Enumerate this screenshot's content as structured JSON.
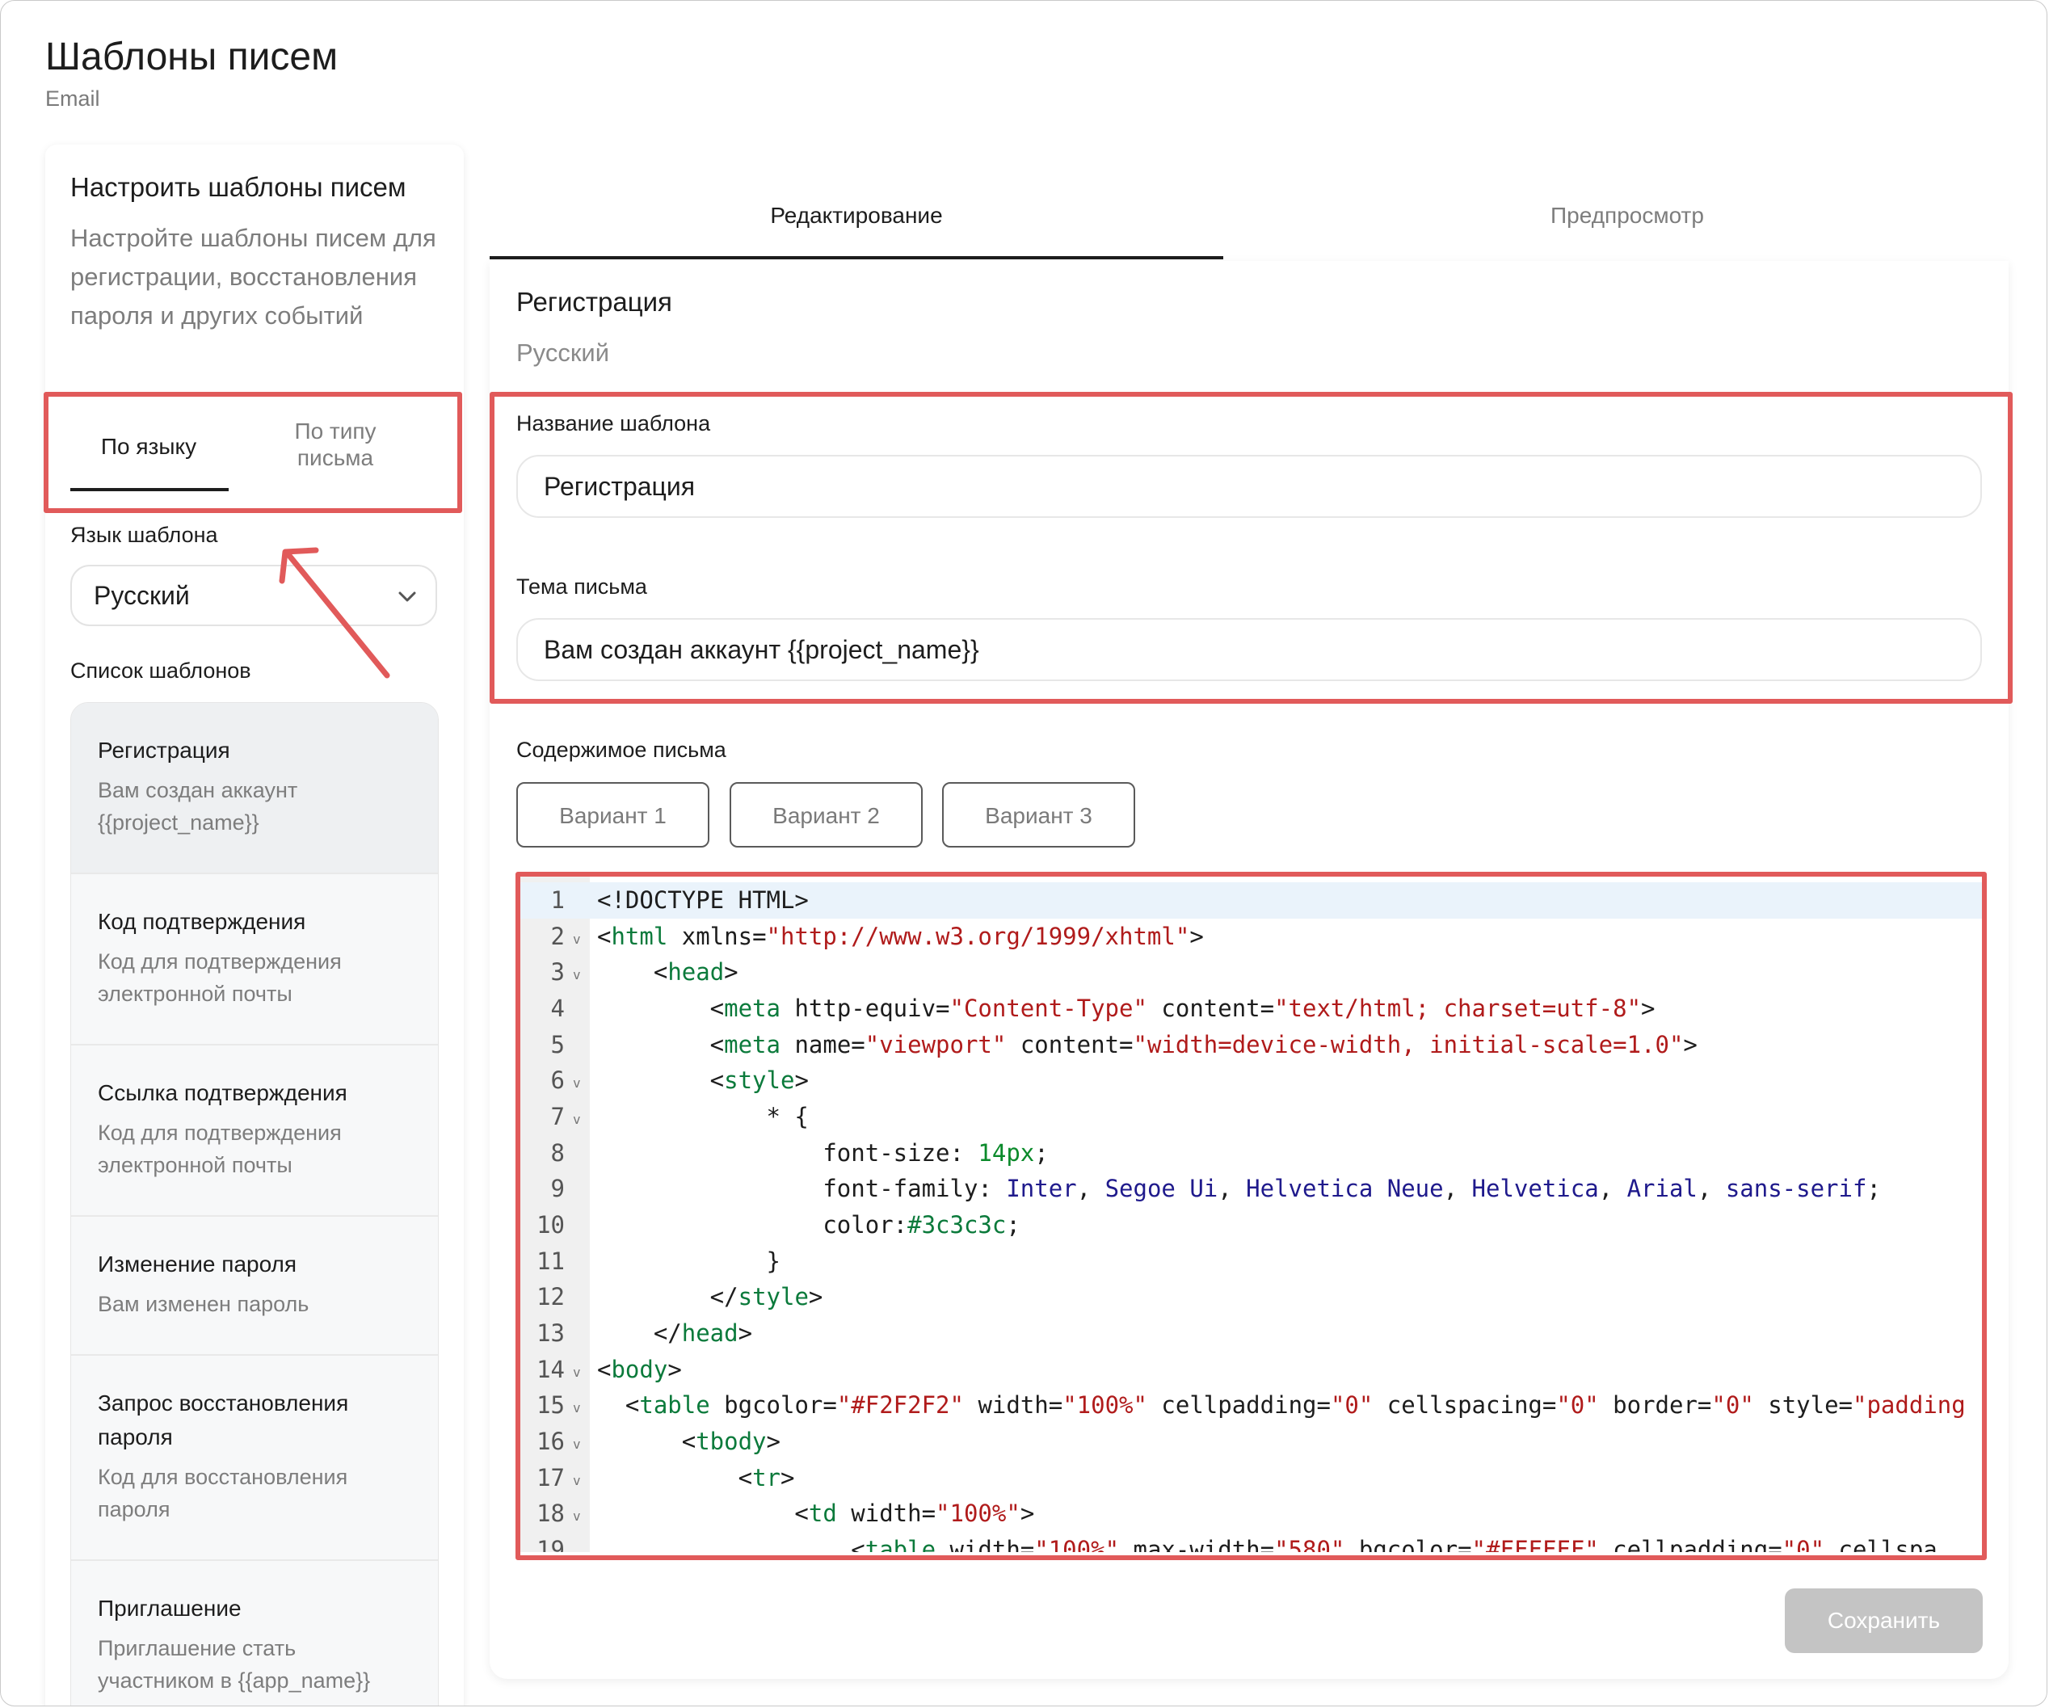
{
  "page": {
    "title": "Шаблоны писем",
    "subtitle": "Email"
  },
  "left": {
    "title": "Настроить шаблоны писем",
    "description": "Настройте шаблоны писем для регистрации, восстановления пароля и других событий",
    "tabs": {
      "by_language": "По языку",
      "by_type_line1": "По типу",
      "by_type_line2": "письма"
    },
    "language_label": "Язык шаблона",
    "language_value": "Русский",
    "list_label": "Список шаблонов",
    "templates": [
      {
        "name": "Регистрация",
        "desc_line1": "Вам создан аккаунт",
        "desc_line2": "{{project_name}}"
      },
      {
        "name": "Код подтверждения",
        "desc_line1": "Код для подтверждения",
        "desc_line2": "электронной почты"
      },
      {
        "name": "Ссылка подтверждения",
        "desc_line1": "Код для подтверждения",
        "desc_line2": "электронной почты"
      },
      {
        "name": "Изменение пароля",
        "desc_line1": "Вам изменен пароль",
        "desc_line2": ""
      },
      {
        "name_line1": "Запрос восстановления",
        "name_line2": "пароля",
        "desc_line1": "Код для восстановления",
        "desc_line2": "пароля"
      },
      {
        "name": "Приглашение",
        "desc_line1": "Приглашение стать",
        "desc_line2": "участником в {{app_name}}"
      }
    ]
  },
  "tabs": {
    "edit": "Редактирование",
    "preview": "Предпросмотр"
  },
  "editor": {
    "title": "Регистрация",
    "language": "Русский",
    "name_label": "Название шаблона",
    "name_value": "Регистрация",
    "subject_label": "Тема письма",
    "subject_value": "Вам создан аккаунт {{project_name}}",
    "content_label": "Содержимое письма",
    "variants": [
      "Вариант 1",
      "Вариант 2",
      "Вариант 3"
    ],
    "save_label": "Сохранить"
  },
  "code": {
    "line_numbers": [
      "1",
      "2",
      "3",
      "4",
      "5",
      "6",
      "7",
      "8",
      "9",
      "10",
      "11",
      "12",
      "13",
      "14",
      "15",
      "16",
      "17",
      "18",
      "19"
    ],
    "fold_marker": "v"
  },
  "colors": {
    "highlight": "#e15a5a",
    "active_line": "#eaf3fb",
    "tag": "#0b7a3b",
    "string": "#b01b1b"
  },
  "icons": {
    "language_select": "chevron-down-icon",
    "annotation": "red-arrow"
  }
}
